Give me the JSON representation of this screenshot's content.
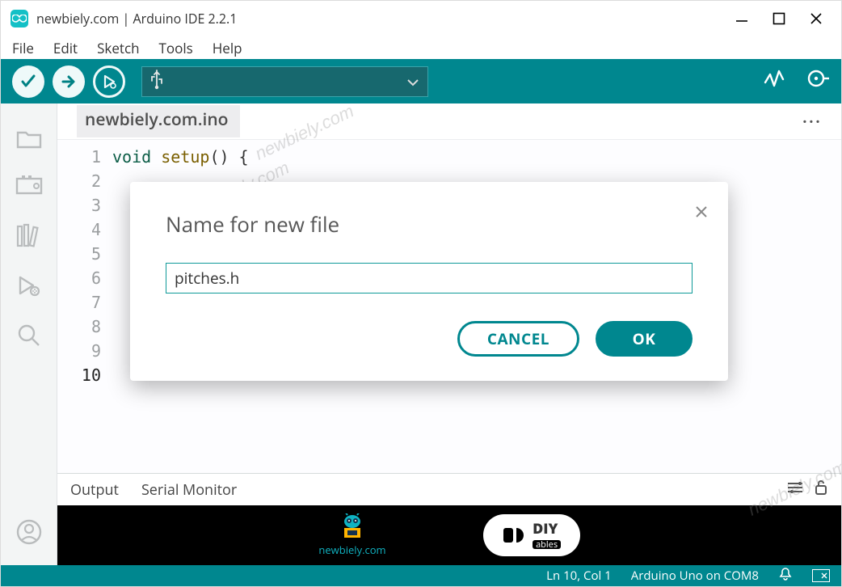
{
  "window": {
    "title": "newbiely.com | Arduino IDE 2.2.1"
  },
  "menu": {
    "file": "File",
    "edit": "Edit",
    "sketch": "Sketch",
    "tools": "Tools",
    "help": "Help"
  },
  "toolbar": {
    "port_icon": "usb-icon"
  },
  "tabs": {
    "sketch_name": "newbiely.com.ino"
  },
  "editor": {
    "lines": [
      "1",
      "2",
      "3",
      "4",
      "5",
      "6",
      "7",
      "8",
      "9",
      "10"
    ],
    "code_line1_kw": "void",
    "code_line1_call": "setup",
    "code_line1_tail": "() {"
  },
  "bottom": {
    "output": "Output",
    "serial": "Serial Monitor"
  },
  "output_strip": {
    "newbiely": "newbiely.com",
    "diy_top": "DIY",
    "diy_bottom": "ables"
  },
  "status": {
    "pos": "Ln 10, Col 1",
    "board": "Arduino Uno on COM8"
  },
  "modal": {
    "title": "Name for new file",
    "value": "pitches.h",
    "cancel": "CANCEL",
    "ok": "OK"
  },
  "watermark": "newbiely.com"
}
